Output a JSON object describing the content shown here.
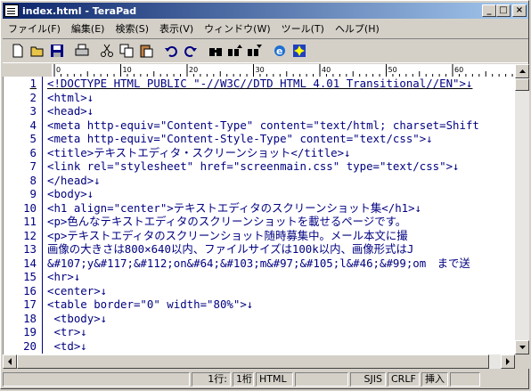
{
  "window": {
    "title": "index.html - TeraPad"
  },
  "menu": [
    "ファイル(F)",
    "編集(E)",
    "検索(S)",
    "表示(V)",
    "ウィンドウ(W)",
    "ツール(T)",
    "ヘルプ(H)"
  ],
  "toolbar": {
    "icons": [
      "new-file-icon",
      "open-folder-icon",
      "save-icon",
      "print-icon",
      "cut-icon",
      "copy-icon",
      "paste-icon",
      "undo-icon",
      "redo-icon",
      "find-icon",
      "find-next-icon",
      "find-prev-icon",
      "browser-icon",
      "settings-icon"
    ]
  },
  "ruler": {
    "marks": [
      "0",
      "10",
      "20",
      "30",
      "40",
      "50",
      "60"
    ]
  },
  "editor": {
    "lines": [
      {
        "n": "1",
        "text": "<!DOCTYPE HTML PUBLIC \"-//W3C//DTD HTML 4.01 Transitional//EN\">↓"
      },
      {
        "n": "2",
        "text": "<html>↓"
      },
      {
        "n": "3",
        "text": "<head>↓"
      },
      {
        "n": "4",
        "text": "<meta http-equiv=\"Content-Type\" content=\"text/html; charset=Shift"
      },
      {
        "n": "5",
        "text": "<meta http-equiv=\"Content-Style-Type\" content=\"text/css\">↓"
      },
      {
        "n": "6",
        "text": "<title>テキストエディタ・スクリーンショット</title>↓"
      },
      {
        "n": "7",
        "text": "<link rel=\"stylesheet\" href=\"screenmain.css\" type=\"text/css\">↓"
      },
      {
        "n": "8",
        "text": "</head>↓"
      },
      {
        "n": "9",
        "text": "<body>↓"
      },
      {
        "n": "10",
        "text": "<h1 align=\"center\">テキストエディタのスクリーンショット集</h1>↓"
      },
      {
        "n": "11",
        "text": "<p>色んなテキストエディタのスクリーンショットを載せるページです。"
      },
      {
        "n": "12",
        "text": "<p>テキストエディタのスクリーンショット随時募集中。メール本文に撮"
      },
      {
        "n": "13",
        "text": "画像の大きさは800×640以内、ファイルサイズは100k以内、画像形式はJ"
      },
      {
        "n": "14",
        "text": "&#107;y&#117;&#112;on&#64;&#103;m&#97;&#105;l&#46;&#99;om　まで送"
      },
      {
        "n": "15",
        "text": "<hr>↓"
      },
      {
        "n": "16",
        "text": "<center>↓"
      },
      {
        "n": "17",
        "text": "<table border=\"0\" width=\"80%\">↓"
      },
      {
        "n": "18",
        "text": "    <tbody>↓"
      },
      {
        "n": "19",
        "text": "        <tr>↓"
      },
      {
        "n": "20",
        "text": "            <td>↓"
      }
    ]
  },
  "status": {
    "position": "1行:",
    "column": "1桁",
    "mode": "HTML",
    "encoding": "SJIS",
    "newline": "CRLF",
    "insert": "挿入"
  }
}
